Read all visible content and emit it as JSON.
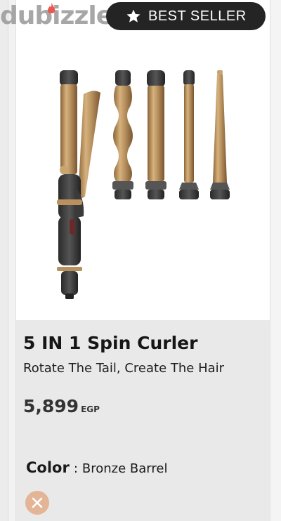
{
  "brand": {
    "logo_text": "dubizzle"
  },
  "badge": {
    "label": "BEST SELLER",
    "icon": "star-icon"
  },
  "product": {
    "title": "5 IN 1 Spin Curler",
    "tagline": "Rotate The Tail, Create The Hair",
    "price": "5,899",
    "currency": "EGP",
    "color_label": "Color",
    "color_separator": ":",
    "color_value": "Bronze Barrel"
  },
  "swatch": {
    "icon": "close-icon",
    "color": "#e3b596"
  },
  "colors": {
    "badge_bg": "#242424",
    "details_bg": "#e9e9e9",
    "bronze": "#b8915f"
  }
}
